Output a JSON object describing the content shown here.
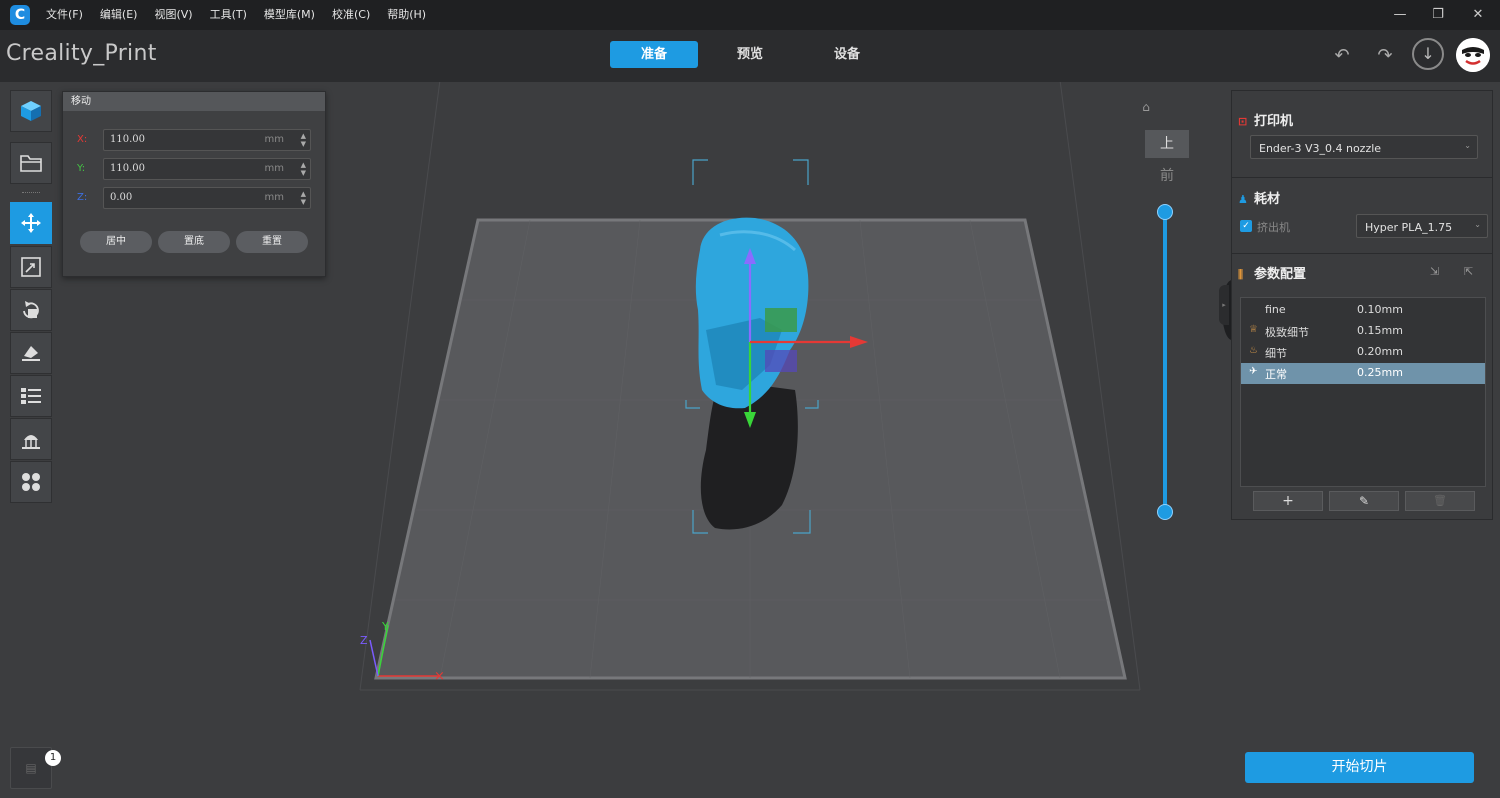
{
  "app": {
    "name": "Creality_Print",
    "logo_letter": "C"
  },
  "menu": [
    "文件(F)",
    "编辑(E)",
    "视图(V)",
    "工具(T)",
    "模型库(M)",
    "校准(C)",
    "帮助(H)"
  ],
  "window_controls": {
    "minimize": "—",
    "restore": "❐",
    "close": "✕"
  },
  "mode_tabs": [
    {
      "label": "准备",
      "active": true
    },
    {
      "label": "预览",
      "active": false
    },
    {
      "label": "设备",
      "active": false
    }
  ],
  "toolbar_icons": {
    "undo": "↶",
    "redo": "↷",
    "download": "↓"
  },
  "move_panel": {
    "title": "移动",
    "x": {
      "axis": "X:",
      "value": "110.00",
      "unit": "mm",
      "color": "#e53935"
    },
    "y": {
      "axis": "Y:",
      "value": "110.00",
      "unit": "mm",
      "color": "#43c443"
    },
    "z": {
      "axis": "Z:",
      "value": "0.00",
      "unit": "mm",
      "color": "#3d6fe0"
    },
    "buttons": [
      "居中",
      "置底",
      "重置"
    ]
  },
  "view_controls": {
    "top_label": "上",
    "front_label": "前"
  },
  "printer": {
    "title": "打印机",
    "selected": "Ender-3 V3_0.4 nozzle"
  },
  "filament": {
    "title": "耗材",
    "extruder_label": "挤出机",
    "selected": "Hyper PLA_1.75"
  },
  "params": {
    "title": "参数配置",
    "profiles": [
      {
        "name": "fine",
        "value": "0.10mm",
        "icon": "",
        "selected": false
      },
      {
        "name": "极致细节",
        "value": "0.15mm",
        "icon": "♕",
        "selected": false
      },
      {
        "name": "细节",
        "value": "0.20mm",
        "icon": "♨",
        "selected": false
      },
      {
        "name": "正常",
        "value": "0.25mm",
        "icon": "✈",
        "selected": true
      }
    ],
    "add_label": "+",
    "edit_label": "✎",
    "delete_label": "🗑"
  },
  "start_slice": "开始切片",
  "notification_count": "1",
  "colors": {
    "accent": "#1e9be2",
    "model": "#2ea6dd",
    "axis_x": "#e53935",
    "axis_y": "#39d639",
    "axis_z": "#7b5cff"
  }
}
